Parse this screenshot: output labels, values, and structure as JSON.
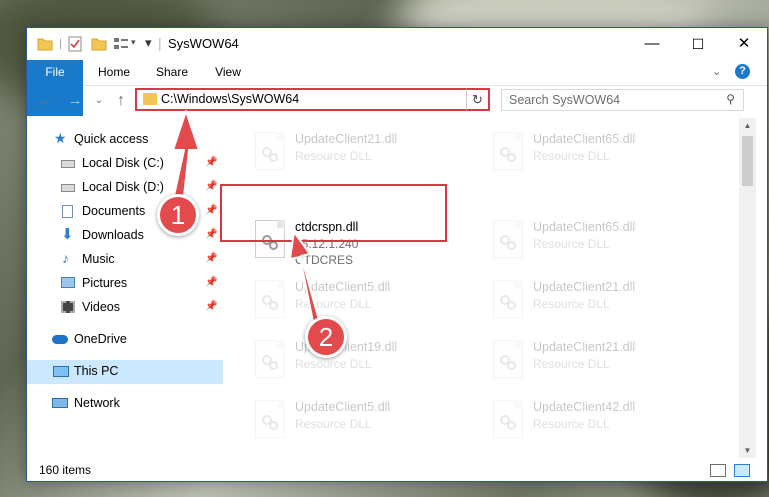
{
  "window": {
    "title": "SysWOW64",
    "controls": {
      "minimize": "—",
      "maximize": "☐",
      "close": "✕"
    }
  },
  "ribbon": {
    "tabs": [
      "File",
      "Home",
      "Share",
      "View"
    ],
    "help": "?"
  },
  "address": {
    "path": "C:\\Windows\\SysWOW64",
    "refresh": "↻"
  },
  "search": {
    "placeholder": "Search SysWOW64",
    "icon": "search-icon"
  },
  "nav": {
    "items": [
      {
        "label": "Quick access",
        "icon": "star-icon"
      },
      {
        "label": "Local Disk (C:)",
        "icon": "drive-icon",
        "pinned": true
      },
      {
        "label": "Local Disk (D:)",
        "icon": "drive-icon",
        "pinned": true
      },
      {
        "label": "Documents",
        "icon": "documents-icon",
        "pinned": true
      },
      {
        "label": "Downloads",
        "icon": "download-icon",
        "pinned": true
      },
      {
        "label": "Music",
        "icon": "music-icon",
        "pinned": true
      },
      {
        "label": "Pictures",
        "icon": "pictures-icon",
        "pinned": true
      },
      {
        "label": "Videos",
        "icon": "videos-icon",
        "pinned": true
      },
      {
        "label": "OneDrive",
        "icon": "cloud-icon"
      },
      {
        "label": "This PC",
        "icon": "computer-icon",
        "selected": true
      },
      {
        "label": "Network",
        "icon": "network-icon"
      }
    ]
  },
  "files": {
    "col1": [
      {
        "name": "UpdateClient21.dll",
        "type": "Resource DLL"
      },
      {
        "name": "ctdcrspn.dll",
        "version": "15.12.1.240",
        "company": "CTDCRES",
        "highlighted": true
      },
      {
        "name": "UpdateClient5.dll",
        "type": "Resource DLL"
      },
      {
        "name": "UpdateClient19.dll",
        "type": "Resource DLL"
      },
      {
        "name": "UpdateClient5.dll",
        "type": "Resource DLL"
      }
    ],
    "col2": [
      {
        "name": "UpdateClient65.dll",
        "type": "Resource DLL"
      },
      {
        "name": "UpdateClient65.dll",
        "type": "Resource DLL"
      },
      {
        "name": "UpdateClient21.dll",
        "type": "Resource DLL"
      },
      {
        "name": "UpdateClient21.dll",
        "type": "Resource DLL"
      },
      {
        "name": "UpdateClient42.dll",
        "type": "Resource DLL"
      }
    ]
  },
  "status": {
    "count": "160 items"
  },
  "callouts": {
    "one": "1",
    "two": "2"
  },
  "colors": {
    "accent": "#1979ca",
    "highlight": "#d6393f",
    "selected": "#cce8ff"
  }
}
